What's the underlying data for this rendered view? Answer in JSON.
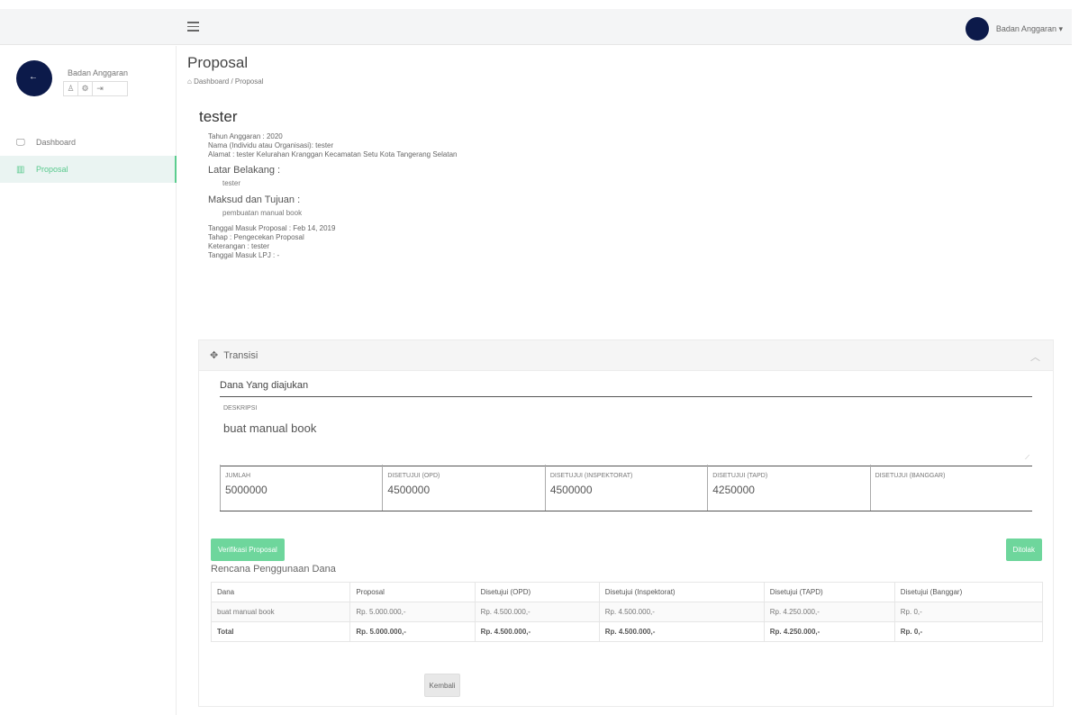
{
  "topbar": {
    "user_name": "Badan Anggaran ▾"
  },
  "sidebar": {
    "profile_name": "Badan Anggaran",
    "profile_icons": [
      "user-icon",
      "settings-icon",
      "logout-icon"
    ],
    "items": [
      {
        "label": "Dashboard",
        "icon": "monitor-icon"
      },
      {
        "label": "Proposal",
        "icon": "grid-icon"
      }
    ]
  },
  "page": {
    "title": "Proposal",
    "breadcrumb": "Dashboard / Proposal"
  },
  "detail": {
    "title": "tester",
    "tahun": "Tahun Anggaran : 2020",
    "nama": "Nama (Individu atau Organisasi): tester",
    "alamat": "Alamat : tester Kelurahan Kranggan Kecamatan Setu Kota Tangerang Selatan",
    "latar_label": "Latar Belakang :",
    "latar_value": "tester",
    "maksud_label": "Maksud dan Tujuan :",
    "maksud_value": "pembuatan manual book",
    "tanggal_masuk": "Tanggal Masuk Proposal : Feb 14, 2019",
    "tahap": "Tahap : Pengecekan Proposal",
    "keterangan": "Keterangan : tester",
    "tanggal_lpj": "Tanggal Masuk LPJ : -"
  },
  "card": {
    "header": "Transisi",
    "section_title": "Dana Yang diajukan",
    "desc_label": "DESKRIPSI",
    "desc_value": "buat manual book",
    "amounts": [
      {
        "label": "JUMLAH",
        "value": "5000000"
      },
      {
        "label": "DISETUJUI (OPD)",
        "value": "4500000"
      },
      {
        "label": "DISETUJUI (INSPEKTORAT)",
        "value": "4500000"
      },
      {
        "label": "DISETUJUI (TAPD)",
        "value": "4250000"
      },
      {
        "label": "DISETUJUI (BANGGAR)",
        "value": ""
      }
    ],
    "verify_label": "Verifikasi Proposal",
    "reject_label": "Ditolak",
    "plan_title": "Rencana Penggunaan Dana",
    "table": {
      "headers": [
        "Dana",
        "Proposal",
        "Disetujui (OPD)",
        "Disetujui (Inspektorat)",
        "Disetujui (TAPD)",
        "Disetujui (Banggar)"
      ],
      "rows": [
        [
          "buat manual book",
          "Rp. 5.000.000,-",
          "Rp. 4.500.000,-",
          "Rp. 4.500.000,-",
          "Rp. 4.250.000,-",
          "Rp. 0,-"
        ],
        [
          "Total",
          "Rp. 5.000.000,-",
          "Rp. 4.500.000,-",
          "Rp. 4.500.000,-",
          "Rp. 4.250.000,-",
          "Rp. 0,-"
        ]
      ]
    },
    "back_label": "Kembali"
  }
}
